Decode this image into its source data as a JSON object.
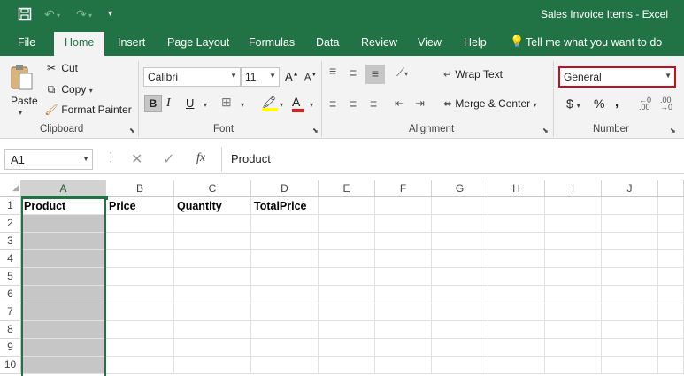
{
  "window": {
    "title": "Sales Invoice Items  -  Excel"
  },
  "tabs": [
    {
      "label": "File"
    },
    {
      "label": "Home"
    },
    {
      "label": "Insert"
    },
    {
      "label": "Page Layout"
    },
    {
      "label": "Formulas"
    },
    {
      "label": "Data"
    },
    {
      "label": "Review"
    },
    {
      "label": "View"
    },
    {
      "label": "Help"
    }
  ],
  "tell_me": "Tell me what you want to do",
  "clipboard": {
    "paste": "Paste",
    "cut": "Cut",
    "copy": "Copy",
    "format_painter": "Format Painter",
    "group": "Clipboard"
  },
  "font": {
    "name": "Calibri",
    "size": "11",
    "bold": "B",
    "italic": "I",
    "underline": "U",
    "group": "Font"
  },
  "alignment": {
    "wrap_text": "Wrap Text",
    "merge_center": "Merge & Center",
    "group": "Alignment"
  },
  "number": {
    "format": "General",
    "currency": "$",
    "percent": "%",
    "comma": ",",
    "group": "Number"
  },
  "formula_bar": {
    "name_box": "A1",
    "fx": "fx",
    "value": "Product"
  },
  "columns": [
    "A",
    "B",
    "C",
    "D",
    "E",
    "F",
    "G",
    "H",
    "I",
    "J"
  ],
  "rows": [
    "1",
    "2",
    "3",
    "4",
    "5",
    "6",
    "7",
    "8",
    "9",
    "10"
  ],
  "headers": {
    "A1": "Product",
    "B1": "Price",
    "C1": "Quantity",
    "D1": "TotalPrice"
  },
  "colors": {
    "brand": "#217346",
    "highlight": "#c50f1f",
    "selection": "#c6c6c6"
  }
}
